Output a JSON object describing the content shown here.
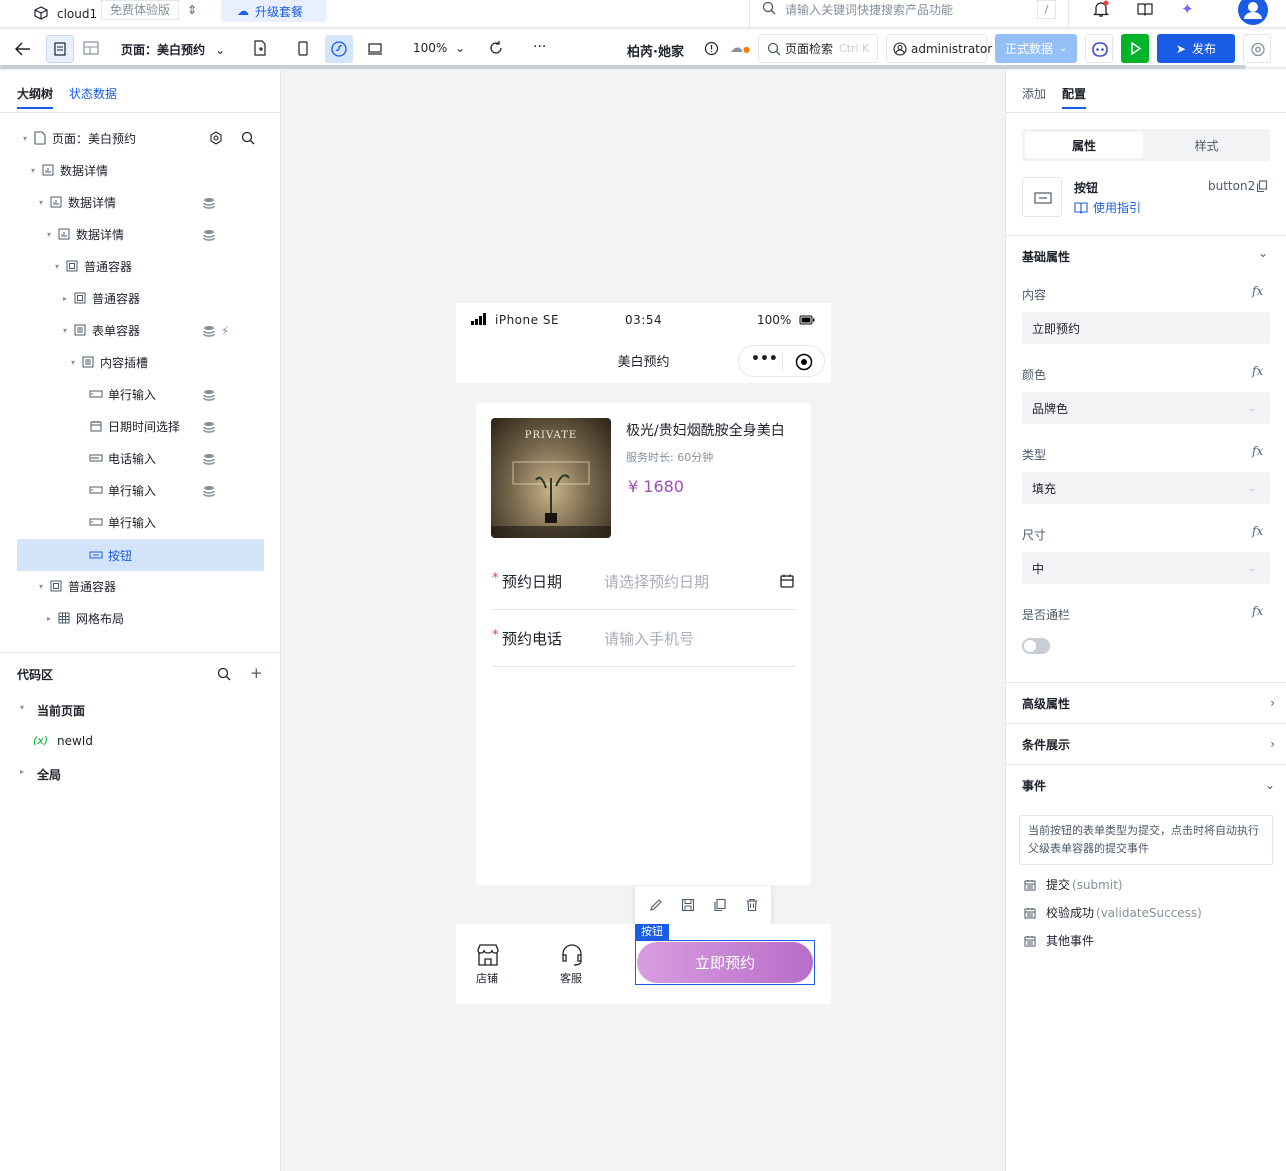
{
  "topbar": {
    "app_name": "cloud1",
    "plan_badge": "免费体验版",
    "upgrade": "升级套餐",
    "search_placeholder": "请输入关键词快捷搜索产品功能",
    "shortcut": "/"
  },
  "toolbar": {
    "page_label": "页面：美白预约",
    "zoom": "100%",
    "app_title": "柏芮·她家",
    "page_search": "页面检索",
    "page_search_shortcut": "Ctrl K",
    "user": "administrator",
    "data_env": "正式数据",
    "publish": "发布"
  },
  "left": {
    "tabs": [
      "大纲树",
      "状态数据"
    ],
    "tree": [
      {
        "label": "页面：美白预约"
      },
      {
        "label": "数据详情"
      },
      {
        "label": "数据详情"
      },
      {
        "label": "数据详情"
      },
      {
        "label": "普通容器"
      },
      {
        "label": "普通容器"
      },
      {
        "label": "表单容器"
      },
      {
        "label": "内容插槽"
      },
      {
        "label": "单行输入"
      },
      {
        "label": "日期时间选择"
      },
      {
        "label": "电话输入"
      },
      {
        "label": "单行输入"
      },
      {
        "label": "单行输入"
      },
      {
        "label": "按钮"
      },
      {
        "label": "普通容器"
      },
      {
        "label": "网格布局"
      }
    ],
    "code_area": {
      "title": "代码区",
      "current_page": "当前页面",
      "var_prefix": "(x)",
      "var_name": "newId",
      "global": "全局"
    }
  },
  "phone": {
    "carrier": "iPhone SE",
    "time": "03:54",
    "battery": "100%",
    "title": "美白预约",
    "product": {
      "name": "极光/贵妇烟酰胺全身美白",
      "duration": "服务时长: 60分钟",
      "price": "¥ 1680",
      "image_text": "PRIVATE"
    },
    "form": [
      {
        "label": "预约日期",
        "placeholder": "请选择预约日期",
        "required": "*"
      },
      {
        "label": "预约电话",
        "placeholder": "请输入手机号",
        "required": "*"
      }
    ],
    "bottom": {
      "store": "店铺",
      "service": "客服",
      "selected_tag": "按钮",
      "cta": "立即预约"
    }
  },
  "right": {
    "tabs": [
      "添加",
      "配置"
    ],
    "subtabs": [
      "属性",
      "样式"
    ],
    "component": {
      "name": "按钮",
      "id": "button2",
      "guide": "使用指引"
    },
    "basic_title": "基础属性",
    "fields": [
      {
        "label": "内容",
        "value": "立即预约"
      },
      {
        "label": "颜色",
        "value": "品牌色"
      },
      {
        "label": "类型",
        "value": "填充"
      },
      {
        "label": "尺寸",
        "value": "中"
      }
    ],
    "fullwidth_label": "是否通栏",
    "fx": "fx",
    "sections": [
      "高级属性",
      "条件展示",
      "事件"
    ],
    "event_note": "当前按钮的表单类型为提交，点击时将自动执行父级表单容器的提交事件",
    "events": [
      {
        "name": "提交",
        "code": "(submit)"
      },
      {
        "name": "校验成功",
        "code": "(validateSuccess)"
      },
      {
        "name": "其他事件",
        "code": ""
      }
    ]
  },
  "colors": {
    "brand": "#1a5ce6",
    "cta_start": "#d89ee0",
    "cta_end": "#b86dc8",
    "price": "#a24db8",
    "selected_row": "#d4e4fb"
  }
}
